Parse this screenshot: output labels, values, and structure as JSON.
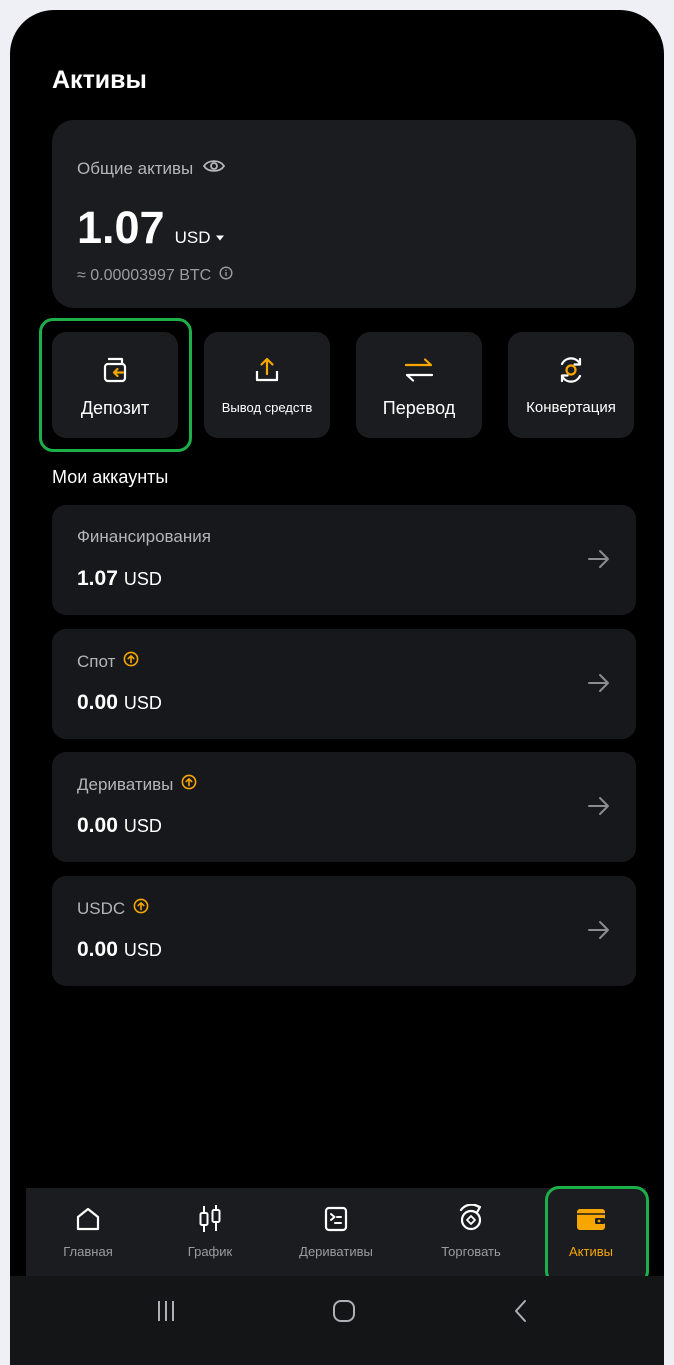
{
  "header": {
    "title": "Активы"
  },
  "total": {
    "label": "Общие активы",
    "amount": "1.07",
    "currency": "USD",
    "btc_equivalent": "≈ 0.00003997 BTC"
  },
  "actions": [
    {
      "label": "Депозит",
      "icon": "deposit-icon"
    },
    {
      "label": "Вывод средств",
      "icon": "upload-icon"
    },
    {
      "label": "Перевод",
      "icon": "transfer-arrows-icon"
    },
    {
      "label": "Конвертация",
      "icon": "convert-coin-icon"
    }
  ],
  "accounts_section": {
    "title": "Мои аккаунты"
  },
  "accounts": [
    {
      "name": "Финансирования",
      "amount": "1.07",
      "currency": "USD",
      "upgrade_badge": false
    },
    {
      "name": "Спот",
      "amount": "0.00",
      "currency": "USD",
      "upgrade_badge": true
    },
    {
      "name": "Деривативы",
      "amount": "0.00",
      "currency": "USD",
      "upgrade_badge": true
    },
    {
      "name": "USDC",
      "amount": "0.00",
      "currency": "USD",
      "upgrade_badge": true
    }
  ],
  "tabs": [
    {
      "label": "Главная",
      "icon": "home-icon",
      "active": false
    },
    {
      "label": "График",
      "icon": "candlestick-icon",
      "active": false
    },
    {
      "label": "Деривативы",
      "icon": "derivatives-icon",
      "active": false
    },
    {
      "label": "Торговать",
      "icon": "trade-icon",
      "active": false
    },
    {
      "label": "Активы",
      "icon": "wallet-icon",
      "active": true
    }
  ],
  "colors": {
    "accent": "#f7a600",
    "highlight": "#1db04a",
    "card": "#1b1c1f",
    "background": "#000000"
  }
}
